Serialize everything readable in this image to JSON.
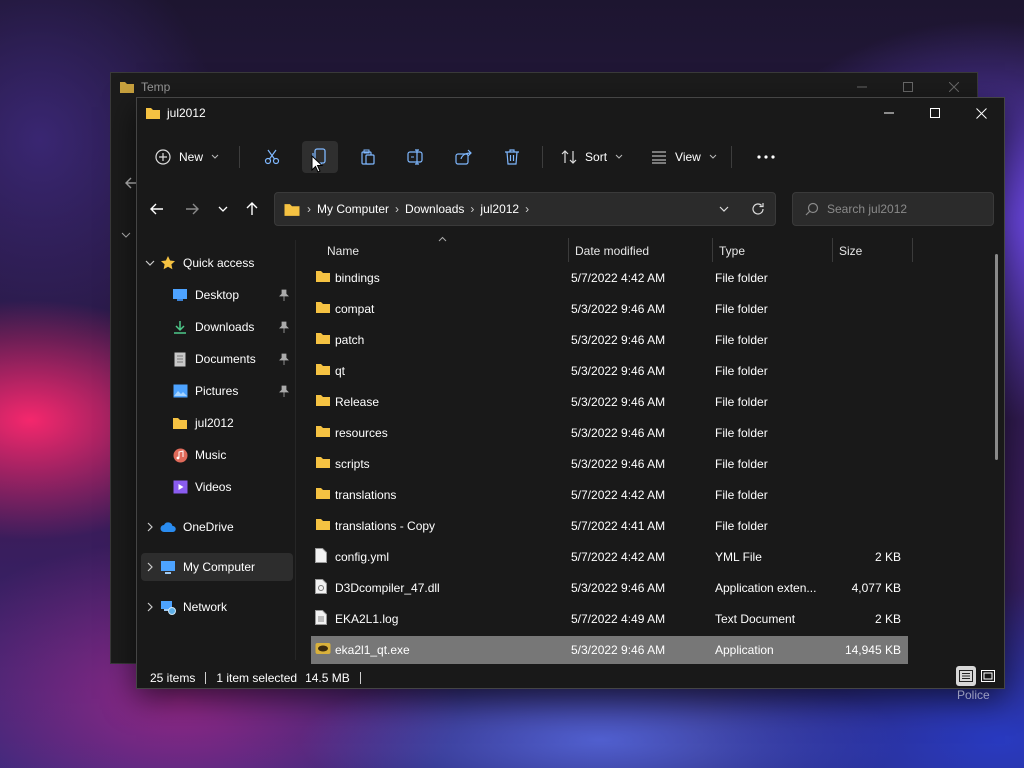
{
  "bg_window": {
    "title": "Temp"
  },
  "window": {
    "title": "jul2012"
  },
  "toolbar": {
    "new_label": "New",
    "sort_label": "Sort",
    "view_label": "View"
  },
  "address": {
    "crumbs": [
      "My Computer",
      "Downloads",
      "jul2012"
    ]
  },
  "search": {
    "placeholder": "Search jul2012"
  },
  "sidebar": {
    "items": [
      {
        "label": "Quick access",
        "icon": "star-icon"
      },
      {
        "label": "Desktop",
        "icon": "desktop-icon",
        "pinned": true
      },
      {
        "label": "Downloads",
        "icon": "download-icon",
        "pinned": true
      },
      {
        "label": "Documents",
        "icon": "document-icon",
        "pinned": true
      },
      {
        "label": "Pictures",
        "icon": "pictures-icon",
        "pinned": true
      },
      {
        "label": "jul2012",
        "icon": "folder-icon"
      },
      {
        "label": "Music",
        "icon": "music-icon"
      },
      {
        "label": "Videos",
        "icon": "videos-icon"
      },
      {
        "label": "OneDrive",
        "icon": "cloud-icon"
      },
      {
        "label": "My Computer",
        "icon": "computer-icon",
        "selected": true
      },
      {
        "label": "Network",
        "icon": "network-icon"
      }
    ]
  },
  "columns": {
    "name": "Name",
    "date": "Date modified",
    "type": "Type",
    "size": "Size"
  },
  "files": [
    {
      "name": "bindings",
      "date": "5/7/2022 4:42 AM",
      "type": "File folder",
      "size": "",
      "kind": "folder"
    },
    {
      "name": "compat",
      "date": "5/3/2022 9:46 AM",
      "type": "File folder",
      "size": "",
      "kind": "folder"
    },
    {
      "name": "patch",
      "date": "5/3/2022 9:46 AM",
      "type": "File folder",
      "size": "",
      "kind": "folder"
    },
    {
      "name": "qt",
      "date": "5/3/2022 9:46 AM",
      "type": "File folder",
      "size": "",
      "kind": "folder"
    },
    {
      "name": "Release",
      "date": "5/3/2022 9:46 AM",
      "type": "File folder",
      "size": "",
      "kind": "folder"
    },
    {
      "name": "resources",
      "date": "5/3/2022 9:46 AM",
      "type": "File folder",
      "size": "",
      "kind": "folder"
    },
    {
      "name": "scripts",
      "date": "5/3/2022 9:46 AM",
      "type": "File folder",
      "size": "",
      "kind": "folder"
    },
    {
      "name": "translations",
      "date": "5/7/2022 4:42 AM",
      "type": "File folder",
      "size": "",
      "kind": "folder"
    },
    {
      "name": "translations - Copy",
      "date": "5/7/2022 4:41 AM",
      "type": "File folder",
      "size": "",
      "kind": "folder"
    },
    {
      "name": "config.yml",
      "date": "5/7/2022 4:42 AM",
      "type": "YML File",
      "size": "2 KB",
      "kind": "file"
    },
    {
      "name": "D3Dcompiler_47.dll",
      "date": "5/3/2022 9:46 AM",
      "type": "Application exten...",
      "size": "4,077 KB",
      "kind": "dll"
    },
    {
      "name": "EKA2L1.log",
      "date": "5/7/2022 4:49 AM",
      "type": "Text Document",
      "size": "2 KB",
      "kind": "text"
    },
    {
      "name": "eka2l1_qt.exe",
      "date": "5/3/2022 9:46 AM",
      "type": "Application",
      "size": "14,945 KB",
      "kind": "exe",
      "selected": true
    }
  ],
  "status": {
    "items": "25 items",
    "selected": "1 item selected",
    "size": "14.5 MB"
  },
  "tooltip": "Police",
  "colors": {
    "folder": "#f5c242",
    "accent_blue": "#4da3ff",
    "selection": "#777777"
  }
}
